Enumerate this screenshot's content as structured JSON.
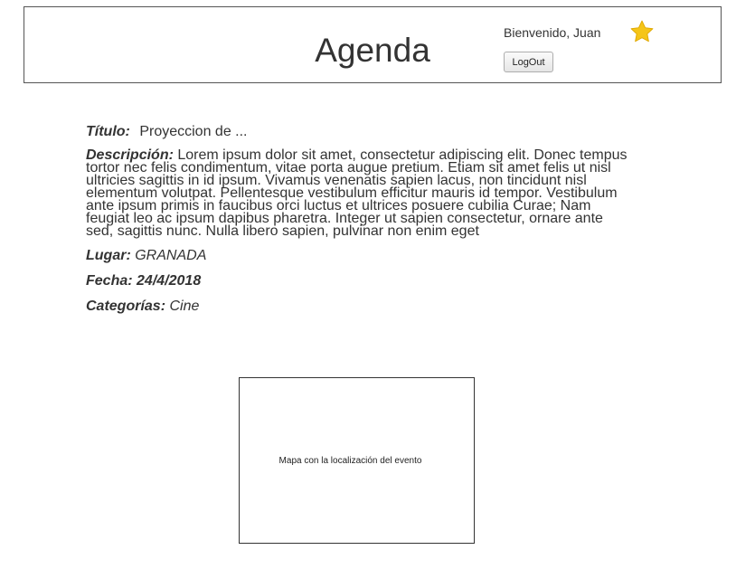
{
  "header": {
    "title": "Agenda",
    "welcome": "Bienvenido, Juan",
    "logout_label": "LogOut",
    "star_color": "#f5c518"
  },
  "event": {
    "title_label": "Título:",
    "title_value": "Proyeccion de ...",
    "description_label": "Descripción:",
    "description_value": "Lorem ipsum dolor sit amet, consectetur adipiscing elit. Donec tempus tortor nec felis condimentum, vitae porta augue pretium. Etiam sit amet felis ut nisl ultricies sagittis in id ipsum. Vivamus venenatis sapien lacus, non tincidunt nisl elementum volutpat. Pellentesque vestibulum efficitur mauris id tempor. Vestibulum ante ipsum primis in faucibus orci luctus et ultrices posuere cubilia Curae; Nam feugiat leo ac ipsum dapibus pharetra. Integer ut sapien consectetur, ornare ante sed, sagittis nunc. Nulla libero sapien, pulvinar non enim eget",
    "place_label": "Lugar:",
    "place_value": "GRANADA",
    "date_label": "Fecha:",
    "date_value": "24/4/2018",
    "categories_label": "Categorías:",
    "categories_value": "Cine"
  },
  "map": {
    "placeholder": "Mapa con la localización del evento"
  }
}
